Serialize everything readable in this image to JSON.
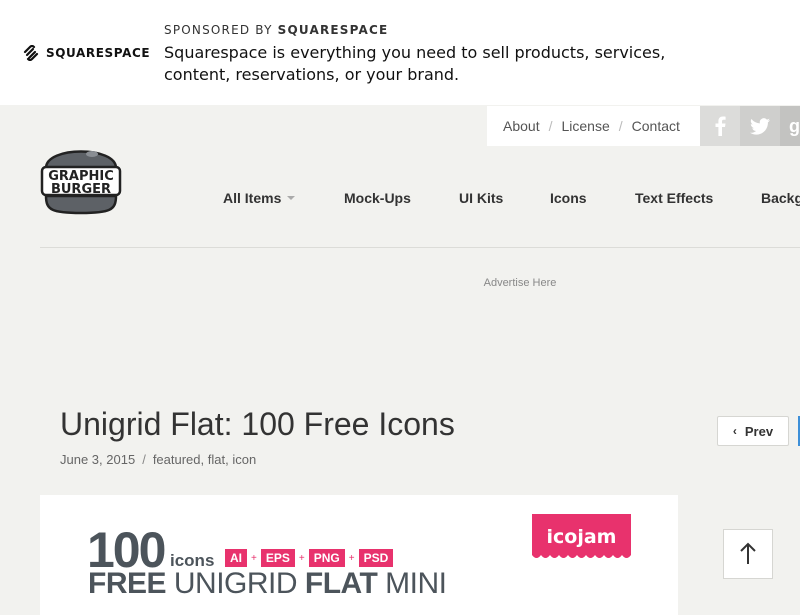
{
  "sponsor": {
    "brand": "SQUARESPACE",
    "label_prefix": "SPONSORED BY",
    "label_brand": "SQUARESPACE",
    "text": "Squarespace is everything you need to sell products, services, content, reservations, or your brand."
  },
  "toplinks": [
    "About",
    "License",
    "Contact"
  ],
  "social": [
    "facebook-icon",
    "twitter-icon",
    "google-plus-icon"
  ],
  "logo": {
    "line1": "GRAPHIC",
    "line2": "BURGER"
  },
  "nav": [
    "All Items",
    "Mock-Ups",
    "UI Kits",
    "Icons",
    "Text Effects",
    "Backg"
  ],
  "advertise": "Advertise Here",
  "article": {
    "title": "Unigrid Flat: 100 Free Icons",
    "date": "June 3, 2015",
    "tags": [
      "featured",
      "flat",
      "icon"
    ],
    "prev_label": "Prev"
  },
  "preview": {
    "big_number": "100",
    "icons_word": "icons",
    "formats": [
      "AI",
      "EPS",
      "PNG",
      "PSD"
    ],
    "sub_free": "FREE",
    "sub_unigrid": "UNIGRID",
    "sub_flat": "FLAT",
    "sub_mini": "MINI",
    "badge": "icojam"
  },
  "colors": {
    "accent_pink": "#e8326d",
    "background": "#f2f2ef",
    "twitter_blue": "#3d8fd8"
  }
}
